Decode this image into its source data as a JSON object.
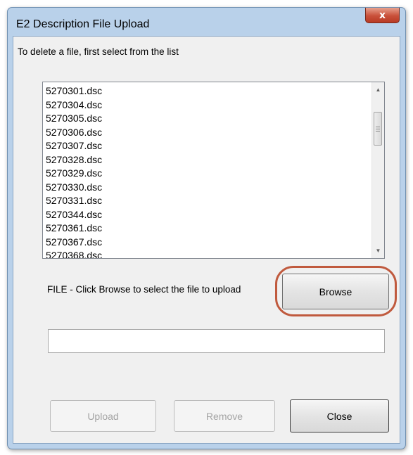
{
  "window": {
    "title": "E2 Description File Upload",
    "close_glyph": "x"
  },
  "instruction": "To delete a file, first select from the list",
  "file_list": {
    "items": [
      "5270301.dsc",
      "5270304.dsc",
      "5270305.dsc",
      "5270306.dsc",
      "5270307.dsc",
      "5270328.dsc",
      "5270329.dsc",
      "5270330.dsc",
      "5270331.dsc",
      "5270344.dsc",
      "5270361.dsc",
      "5270367.dsc",
      "5270368.dsc"
    ]
  },
  "file_section": {
    "label": "FILE - Click Browse to select the file to upload",
    "browse_label": "Browse",
    "path_value": ""
  },
  "buttons": {
    "upload_label": "Upload",
    "remove_label": "Remove",
    "close_label": "Close"
  },
  "colors": {
    "frame": "#b9d1ea",
    "close_button": "#c9503a",
    "highlight_ring": "#c05a3e"
  },
  "icons": [
    "close-icon",
    "scroll-up-arrow-icon",
    "scroll-down-arrow-icon",
    "scrollbar-grip-icon"
  ]
}
